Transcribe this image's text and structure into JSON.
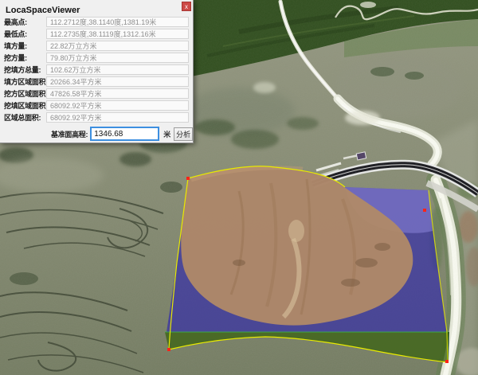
{
  "window": {
    "title": "LocaSpaceViewer",
    "close_glyph": "x"
  },
  "panel": {
    "rows": [
      {
        "label": "最高点:",
        "value": "112.2712度,38.1140度,1381.19米"
      },
      {
        "label": "最低点:",
        "value": "112.2735度,38.1119度,1312.16米"
      },
      {
        "label": "填方量:",
        "value": "22.82万立方米"
      },
      {
        "label": "挖方量:",
        "value": "79.80万立方米"
      },
      {
        "label": "挖填方总量:",
        "value": "102.62万立方米"
      },
      {
        "label": "填方区域面积:",
        "value": "20266.34平方米"
      },
      {
        "label": "挖方区域面积:",
        "value": "47826.58平方米"
      },
      {
        "label": "挖填区域面积:",
        "value": "68092.92平方米"
      },
      {
        "label": "区域总面积:",
        "value": "68092.92平方米"
      }
    ],
    "datum": {
      "label": "基准面高程:",
      "value": "1346.68",
      "unit": "米",
      "analyze_button": "分析"
    }
  },
  "map": {
    "colors": {
      "plane_blue": "#2b22b0",
      "plane_blue_light": "#8a84d8",
      "cut_brown": "#b08a67",
      "skirt_green": "#3f6416",
      "skirt_edge_green": "#39b54a",
      "outline_yellow": "#e8ea00",
      "vertex_red": "#ff2318"
    }
  }
}
